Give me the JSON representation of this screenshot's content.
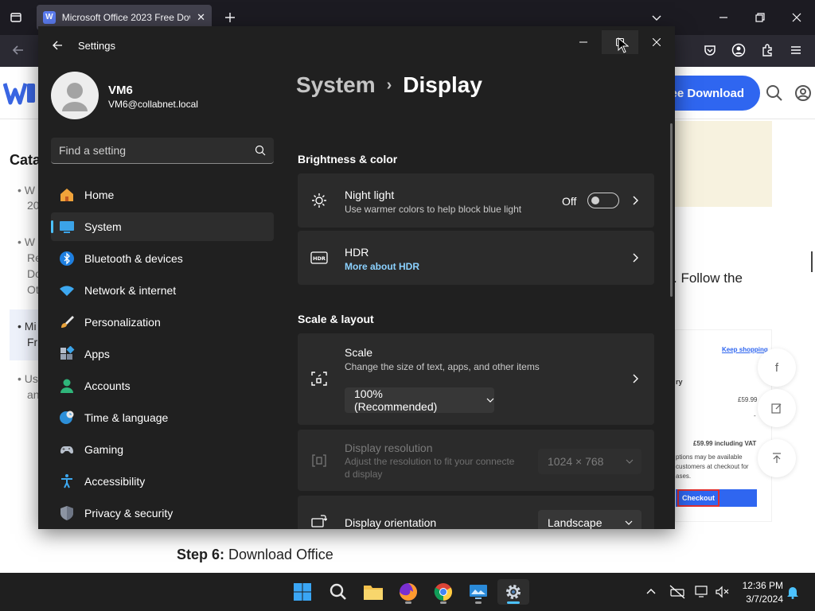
{
  "browser": {
    "tab_title": "Microsoft Office 2023 Free Dow",
    "tab_favicon": "W",
    "colors": {
      "tabstrip": "#1c1b22",
      "toolbar": "#2b2a33",
      "active_tab": "#42414d"
    }
  },
  "webpage": {
    "download_button": "ee Download",
    "catalog_fragment": "Cata",
    "bullet_fragments": [
      "W",
      "20",
      "W",
      "Re",
      "Do",
      "Ot",
      "Mi",
      "Fr",
      "Us",
      "an"
    ],
    "follow_text": ". Follow the",
    "checkout_card": {
      "keep_shopping": "Keep shopping",
      "summary_fragment": "ry",
      "price": "£59.99",
      "dash": "-",
      "vat_line": "£59.99 including VAT",
      "note_line1": "ptions may be available",
      "note_line2": "customers at checkout for",
      "note_line3": "ases.",
      "checkout_label": "Checkout"
    },
    "step_label": "Step 6:",
    "step_text": " Download Office",
    "colors": {
      "accent": "#2f66f0"
    }
  },
  "settings": {
    "window_title": "Settings",
    "user": {
      "name": "VM6",
      "email": "VM6@collabnet.local"
    },
    "search_placeholder": "Find a setting",
    "nav_items": [
      {
        "label": "Home",
        "icon": "home-icon"
      },
      {
        "label": "System",
        "icon": "system-icon",
        "active": true
      },
      {
        "label": "Bluetooth & devices",
        "icon": "bluetooth-icon"
      },
      {
        "label": "Network & internet",
        "icon": "wifi-icon"
      },
      {
        "label": "Personalization",
        "icon": "brush-icon"
      },
      {
        "label": "Apps",
        "icon": "apps-icon"
      },
      {
        "label": "Accounts",
        "icon": "account-icon"
      },
      {
        "label": "Time & language",
        "icon": "globe-clock-icon"
      },
      {
        "label": "Gaming",
        "icon": "gamepad-icon"
      },
      {
        "label": "Accessibility",
        "icon": "accessibility-icon"
      },
      {
        "label": "Privacy & security",
        "icon": "shield-icon"
      }
    ],
    "breadcrumb": {
      "parent": "System",
      "separator": "›",
      "current": "Display"
    },
    "sections": {
      "brightness": "Brightness & color",
      "scale_layout": "Scale & layout"
    },
    "night_light": {
      "title": "Night light",
      "subtitle": "Use warmer colors to help block blue light",
      "state": "Off"
    },
    "hdr": {
      "title": "HDR",
      "link": "More about HDR"
    },
    "scale": {
      "title": "Scale",
      "subtitle": "Change the size of text, apps, and other items",
      "value": "100% (Recommended)"
    },
    "resolution": {
      "title": "Display resolution",
      "subtitle_line1": "Adjust the resolution to fit your connecte",
      "subtitle_line2": "d display",
      "value": "1024 × 768"
    },
    "orientation": {
      "title": "Display orientation",
      "value": "Landscape"
    },
    "colors": {
      "window_bg": "#202020",
      "card_bg": "#2b2b2b",
      "accent": "#4cc2ff",
      "link": "#8bd1ff"
    }
  },
  "taskbar": {
    "apps": [
      "start-icon",
      "search-icon",
      "file-explorer-icon",
      "firefox-icon",
      "chrome-icon",
      "remote-desktop-icon",
      "settings-icon"
    ],
    "time": "12:36 PM",
    "date": "3/7/2024"
  }
}
